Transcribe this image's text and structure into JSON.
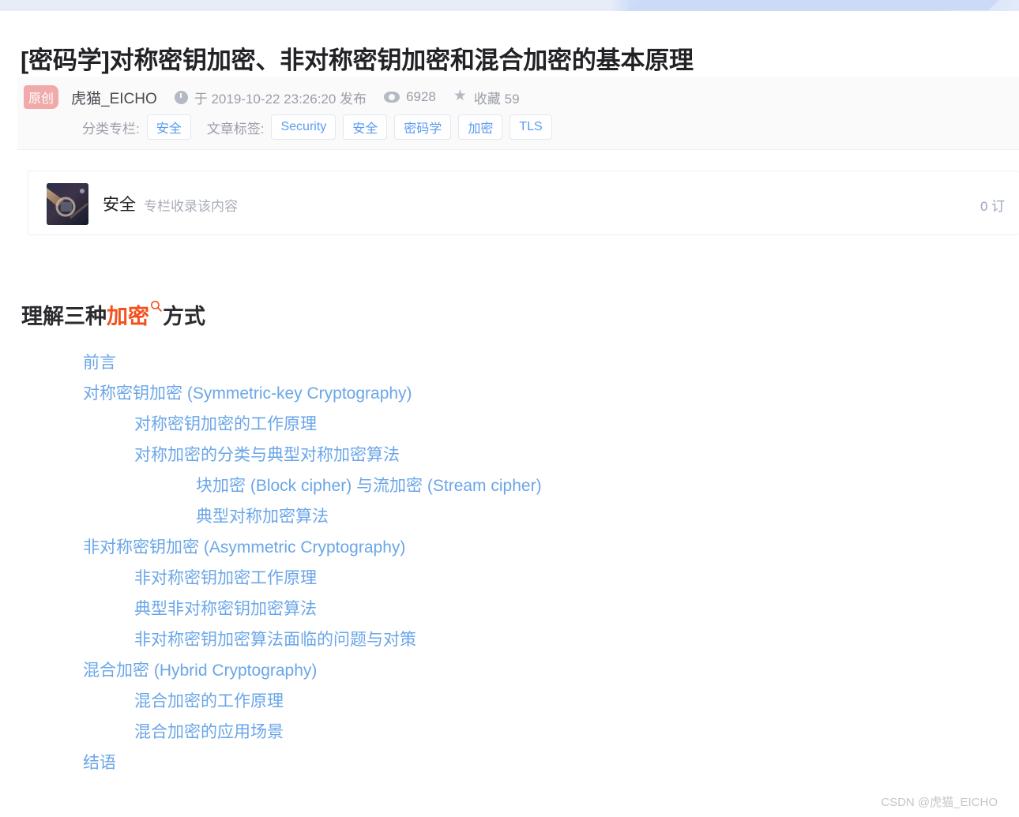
{
  "decor": {
    "top_band_color_left": "#e7ecf8",
    "top_band_color_right": "#cbdaf7"
  },
  "article": {
    "title": "[密码学]对称密钥加密、非对称密钥加密和混合加密的基本原理",
    "badge_original": "原创",
    "author": "虎猫_EICHO",
    "publish_text": "于 2019-10-22 23:26:20 发布",
    "views": "6928",
    "collect_text": "收藏 59",
    "clock_icon": "clock-icon",
    "eye_icon": "eye-icon",
    "star_icon": "star-icon"
  },
  "taxonomy": {
    "category_label": "分类专栏:",
    "categories": [
      "安全"
    ],
    "tag_label": "文章标签:",
    "tags": [
      "Security",
      "安全",
      "密码学",
      "加密",
      "TLS"
    ],
    "chip_text_color": "#5a9bf0"
  },
  "column_card": {
    "thumbnail_icon": "column-thumbnail-image",
    "name": "安全",
    "subtitle": "专栏收录该内容",
    "subscribe_count": "0 订"
  },
  "heading": {
    "prefix": "理解三种",
    "highlight": "加密",
    "suffix": "方式",
    "highlight_color": "#f4511e",
    "search_icon": "search-icon"
  },
  "toc": {
    "link_color": "#6aa6e8",
    "items": [
      {
        "label": "前言",
        "level": 1
      },
      {
        "label": "对称密钥加密 (Symmetric-key Cryptography)",
        "level": 1
      },
      {
        "label": "对称密钥加密的工作原理",
        "level": 2
      },
      {
        "label": "对称加密的分类与典型对称加密算法",
        "level": 2
      },
      {
        "label": "块加密 (Block cipher) 与流加密 (Stream cipher)",
        "level": 3
      },
      {
        "label": "典型对称加密算法",
        "level": 3
      },
      {
        "label": "非对称密钥加密 (Asymmetric Cryptography)",
        "level": 1
      },
      {
        "label": "非对称密钥加密工作原理",
        "level": 2
      },
      {
        "label": "典型非对称密钥加密算法",
        "level": 2
      },
      {
        "label": "非对称密钥加密算法面临的问题与对策",
        "level": 2
      },
      {
        "label": "混合加密 (Hybrid Cryptography)",
        "level": 1
      },
      {
        "label": "混合加密的工作原理",
        "level": 2
      },
      {
        "label": "混合加密的应用场景",
        "level": 2
      },
      {
        "label": "结语",
        "level": 1
      }
    ]
  },
  "watermark": "CSDN @虎猫_EICHO"
}
